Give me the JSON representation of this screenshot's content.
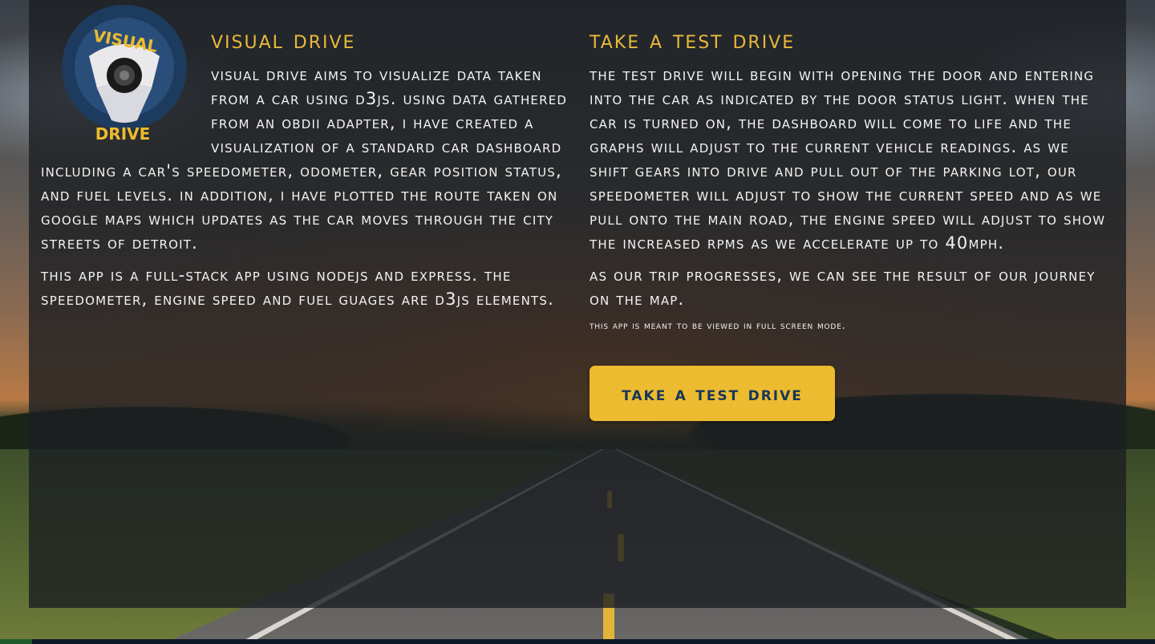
{
  "colors": {
    "accent": "#e8b83a",
    "button_bg": "#ecbb2f",
    "button_text": "#16365a",
    "panel_bg": "rgba(28,30,34,0.80)",
    "body_text": "#f2f2f2"
  },
  "logo": {
    "icon": "steering-wheel-icon",
    "top_text": "VISUAL",
    "bottom_text": "DRIVE"
  },
  "left": {
    "title": "Visual Drive",
    "paragraph1": "Visual Drive aims to visualize data taken from a car using D3js. Using data gathered from an OBDII adapter, I have created a visualization of a standard car dashboard including a car's speedometer, odometer, gear position status, and fuel levels. In addition, I have plotted the route taken on Google Maps which updates as the car moves through the city streets of Detroit.",
    "paragraph2": "This app is a full-stack app using NodeJS and Express. The speedometer, engine speed and fuel guages are D3js elements."
  },
  "right": {
    "title": "Take a Test Drive",
    "paragraph1": "The test drive will begin with opening the door and entering into the car as indicated by the door status light. When the car is turned on, the dashboard will come to life and the graphs will adjust to the current vehicle readings. As we shift gears into drive and pull out of the parking lot, our speedometer will adjust to show the current speed and as we pull onto the main road, the engine speed will adjust to show the increased RPMs as we accelerate up to 40mph.",
    "paragraph2": "As our trip progresses, we can see the result of our journey on the map.",
    "note": "This app is meant to be viewed in full screen mode.",
    "button_label": "Take a Test Drive"
  }
}
